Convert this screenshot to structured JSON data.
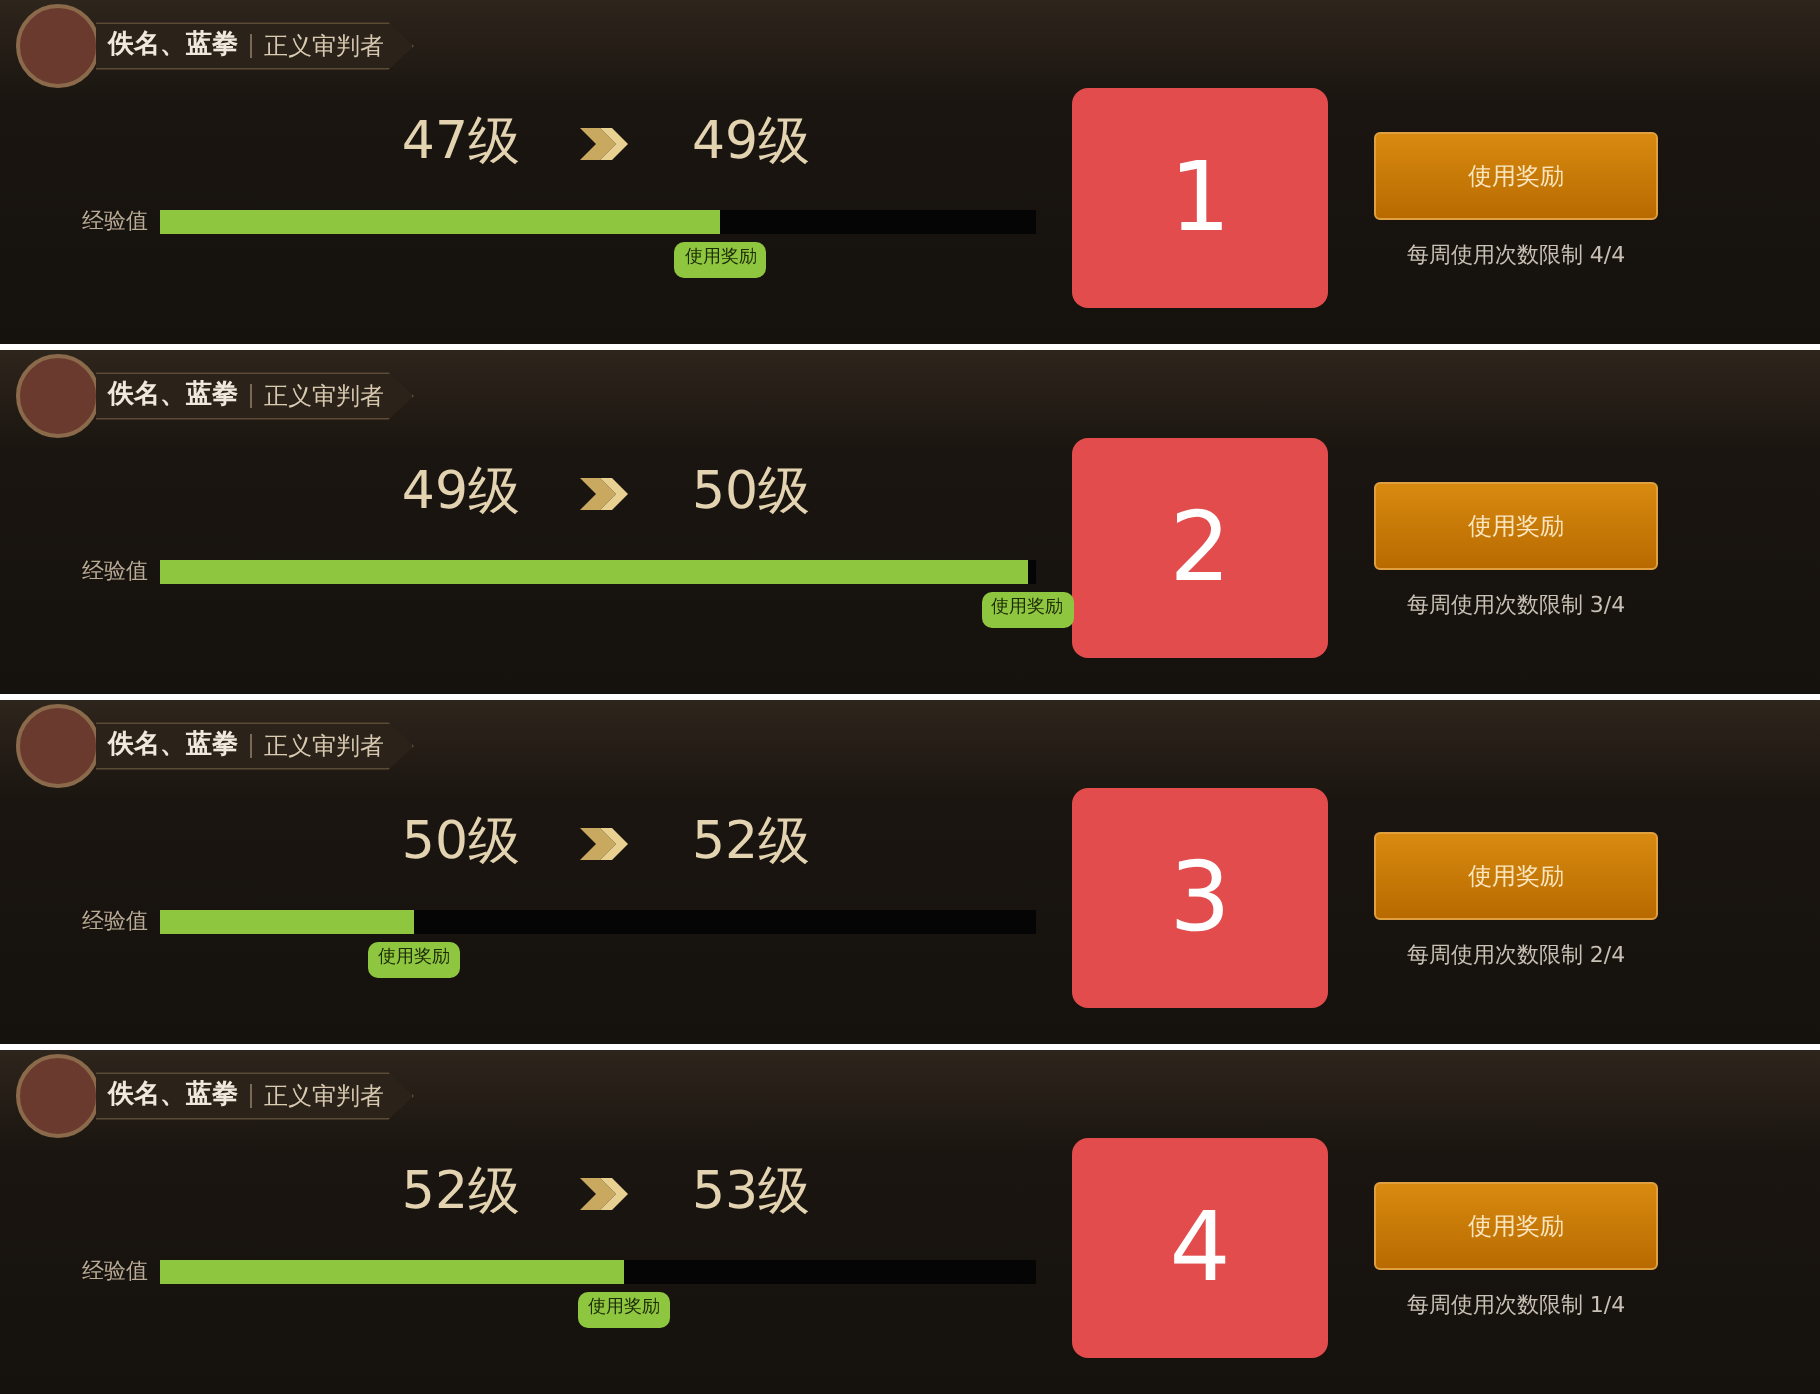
{
  "panels": [
    {
      "name": "佚名、蓝拳",
      "title": "正义审判者",
      "from_level": "47级",
      "to_level": "49级",
      "exp_label": "经验值",
      "level": 0.64,
      "bubble": "使用奖励",
      "number": "1",
      "button": "使用奖励",
      "limit": "每周使用次数限制 4/4"
    },
    {
      "name": "佚名、蓝拳",
      "title": "正义审判者",
      "from_level": "49级",
      "to_level": "50级",
      "exp_label": "经验值",
      "level": 0.99,
      "bubble": "使用奖励",
      "number": "2",
      "button": "使用奖励",
      "limit": "每周使用次数限制 3/4"
    },
    {
      "name": "佚名、蓝拳",
      "title": "正义审判者",
      "from_level": "50级",
      "to_level": "52级",
      "exp_label": "经验值",
      "level": 0.29,
      "bubble": "使用奖励",
      "number": "3",
      "button": "使用奖励",
      "limit": "每周使用次数限制 2/4"
    },
    {
      "name": "佚名、蓝拳",
      "title": "正义审判者",
      "from_level": "52级",
      "to_level": "53级",
      "exp_label": "经验值",
      "level": 0.53,
      "bubble": "使用奖励",
      "number": "4",
      "button": "使用奖励",
      "limit": "每周使用次数限制 1/4"
    }
  ]
}
